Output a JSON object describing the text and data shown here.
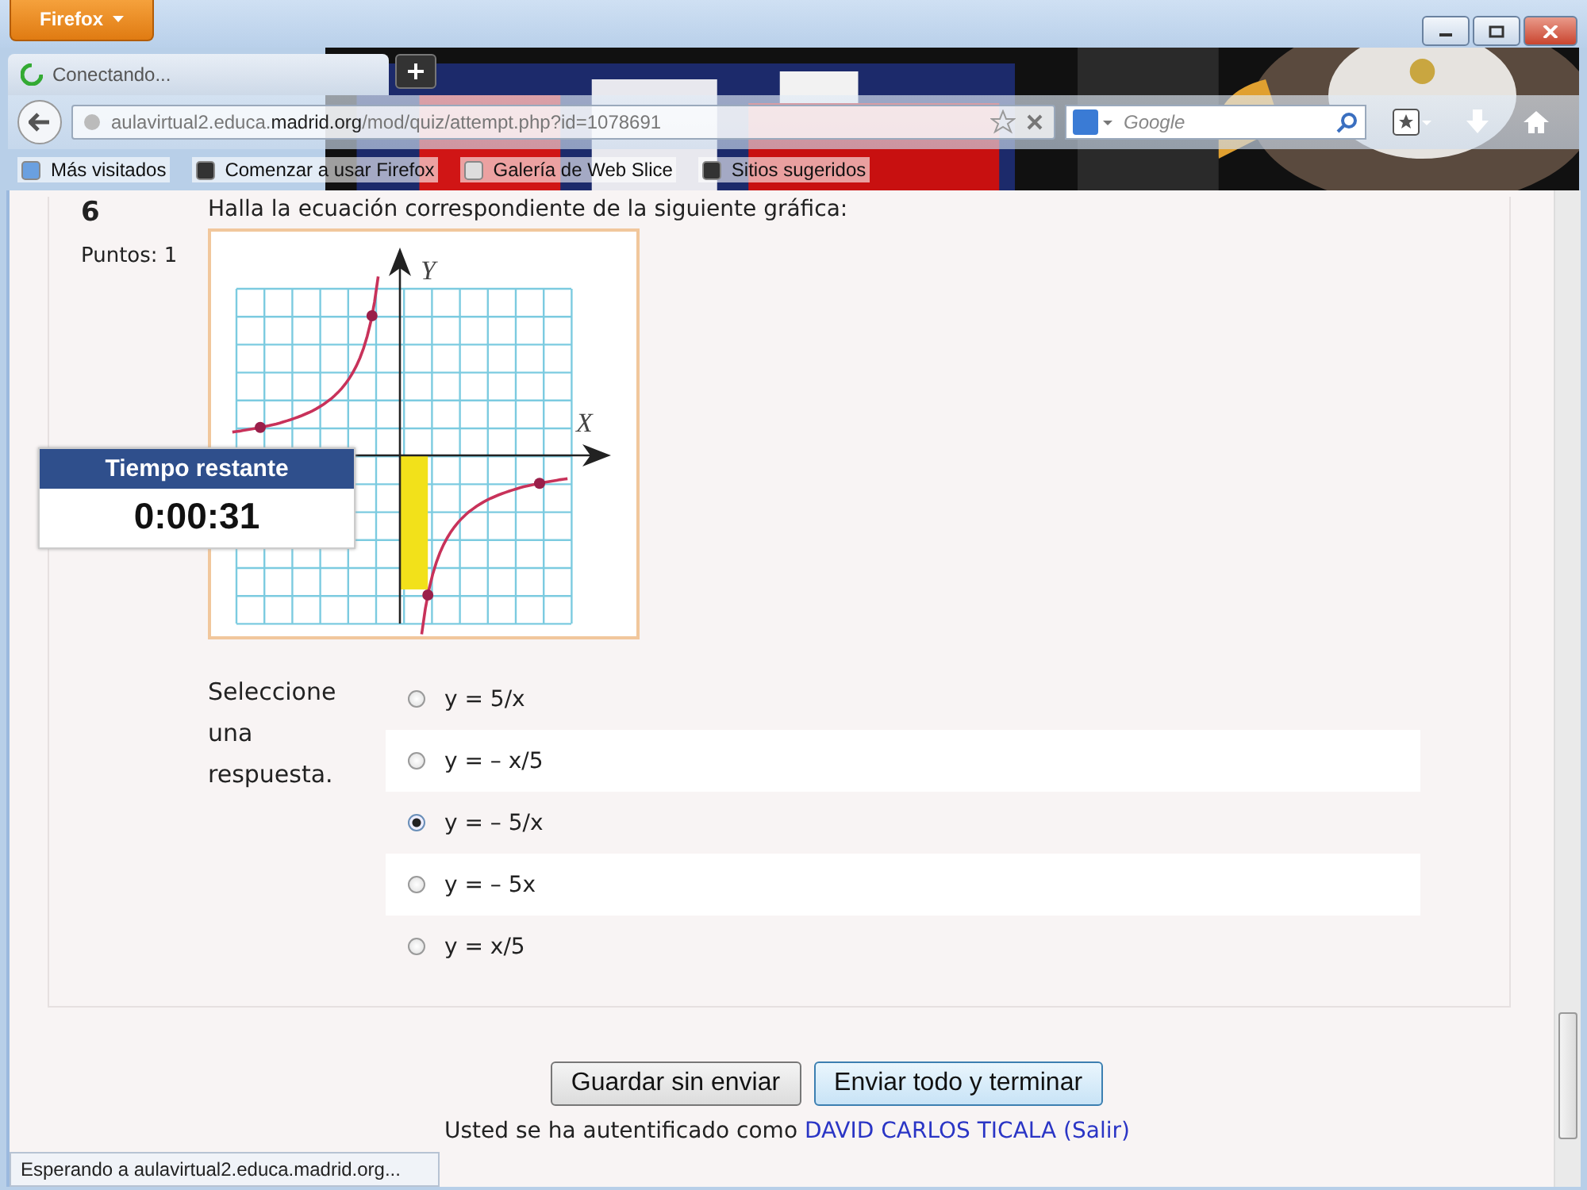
{
  "window": {
    "menu_button": "Firefox"
  },
  "tab": {
    "title": "Conectando..."
  },
  "address_bar": {
    "host_pre": "aulavirtual2.educa.",
    "host": "madrid.org",
    "path": "/mod/quiz/attempt.php?id=1078691"
  },
  "search": {
    "placeholder": "Google"
  },
  "bookmarks": [
    "Más visitados",
    "Comenzar a usar Firefox",
    "Galería de Web Slice",
    "Sitios sugeridos"
  ],
  "question": {
    "number": "6",
    "points": "Puntos: 1",
    "text": "Halla la ecuación correspondiente de la siguiente gráfica:",
    "graph": {
      "x_label": "X",
      "y_label": "Y"
    },
    "prompt": "Seleccione una respuesta.",
    "options": [
      {
        "label": "y = 5/x",
        "selected": false
      },
      {
        "label": "y = – x/5",
        "selected": false
      },
      {
        "label": "y = – 5/x",
        "selected": true
      },
      {
        "label": "y = – 5x",
        "selected": false
      },
      {
        "label": "y = x/5",
        "selected": false
      }
    ]
  },
  "timer": {
    "title": "Tiempo restante",
    "value": "0:00:31"
  },
  "buttons": [
    "Guardar sin enviar",
    "Enviar todo y terminar"
  ],
  "footer": {
    "text": "Usted se ha autentificado como",
    "user": "DAVID CARLOS TICALA",
    "logout": "(Salir)"
  },
  "status": "Esperando a aulavirtual2.educa.madrid.org..."
}
